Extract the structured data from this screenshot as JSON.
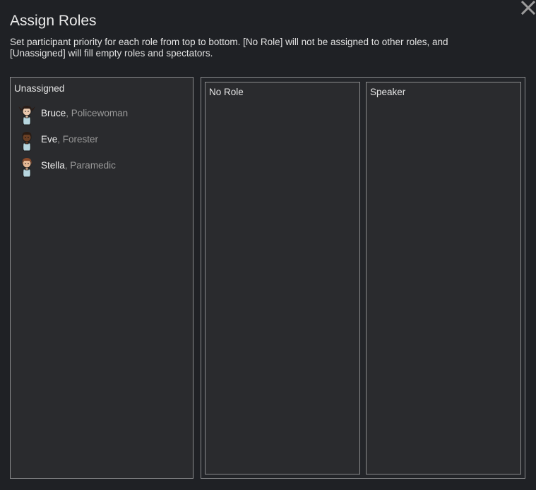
{
  "dialog": {
    "title": "Assign Roles",
    "description": "Set participant priority for each role from top to bottom. [No Role] will not be assigned to other roles, and [Unassigned] will fill empty roles and spectators."
  },
  "unassigned": {
    "label": "Unassigned",
    "pawns": [
      {
        "name": "Bruce",
        "sep": ", ",
        "job": "Policewoman",
        "hair": "#2a1c16",
        "skin": "#e9c8ae"
      },
      {
        "name": "Eve",
        "sep": ", ",
        "job": "Forester",
        "hair": "#2a1b12",
        "skin": "#6a3f24"
      },
      {
        "name": "Stella",
        "sep": ", ",
        "job": "Paramedic",
        "hair": "#8a4a2a",
        "skin": "#e4b895"
      }
    ]
  },
  "roles": [
    {
      "label": "No Role"
    },
    {
      "label": "Speaker"
    }
  ],
  "icons": {
    "close": "close-icon"
  },
  "colors": {
    "background": "#1f2125",
    "panel": "#2a2b2e",
    "border": "#8a8b8d",
    "muted_text": "#9a9a9a"
  }
}
